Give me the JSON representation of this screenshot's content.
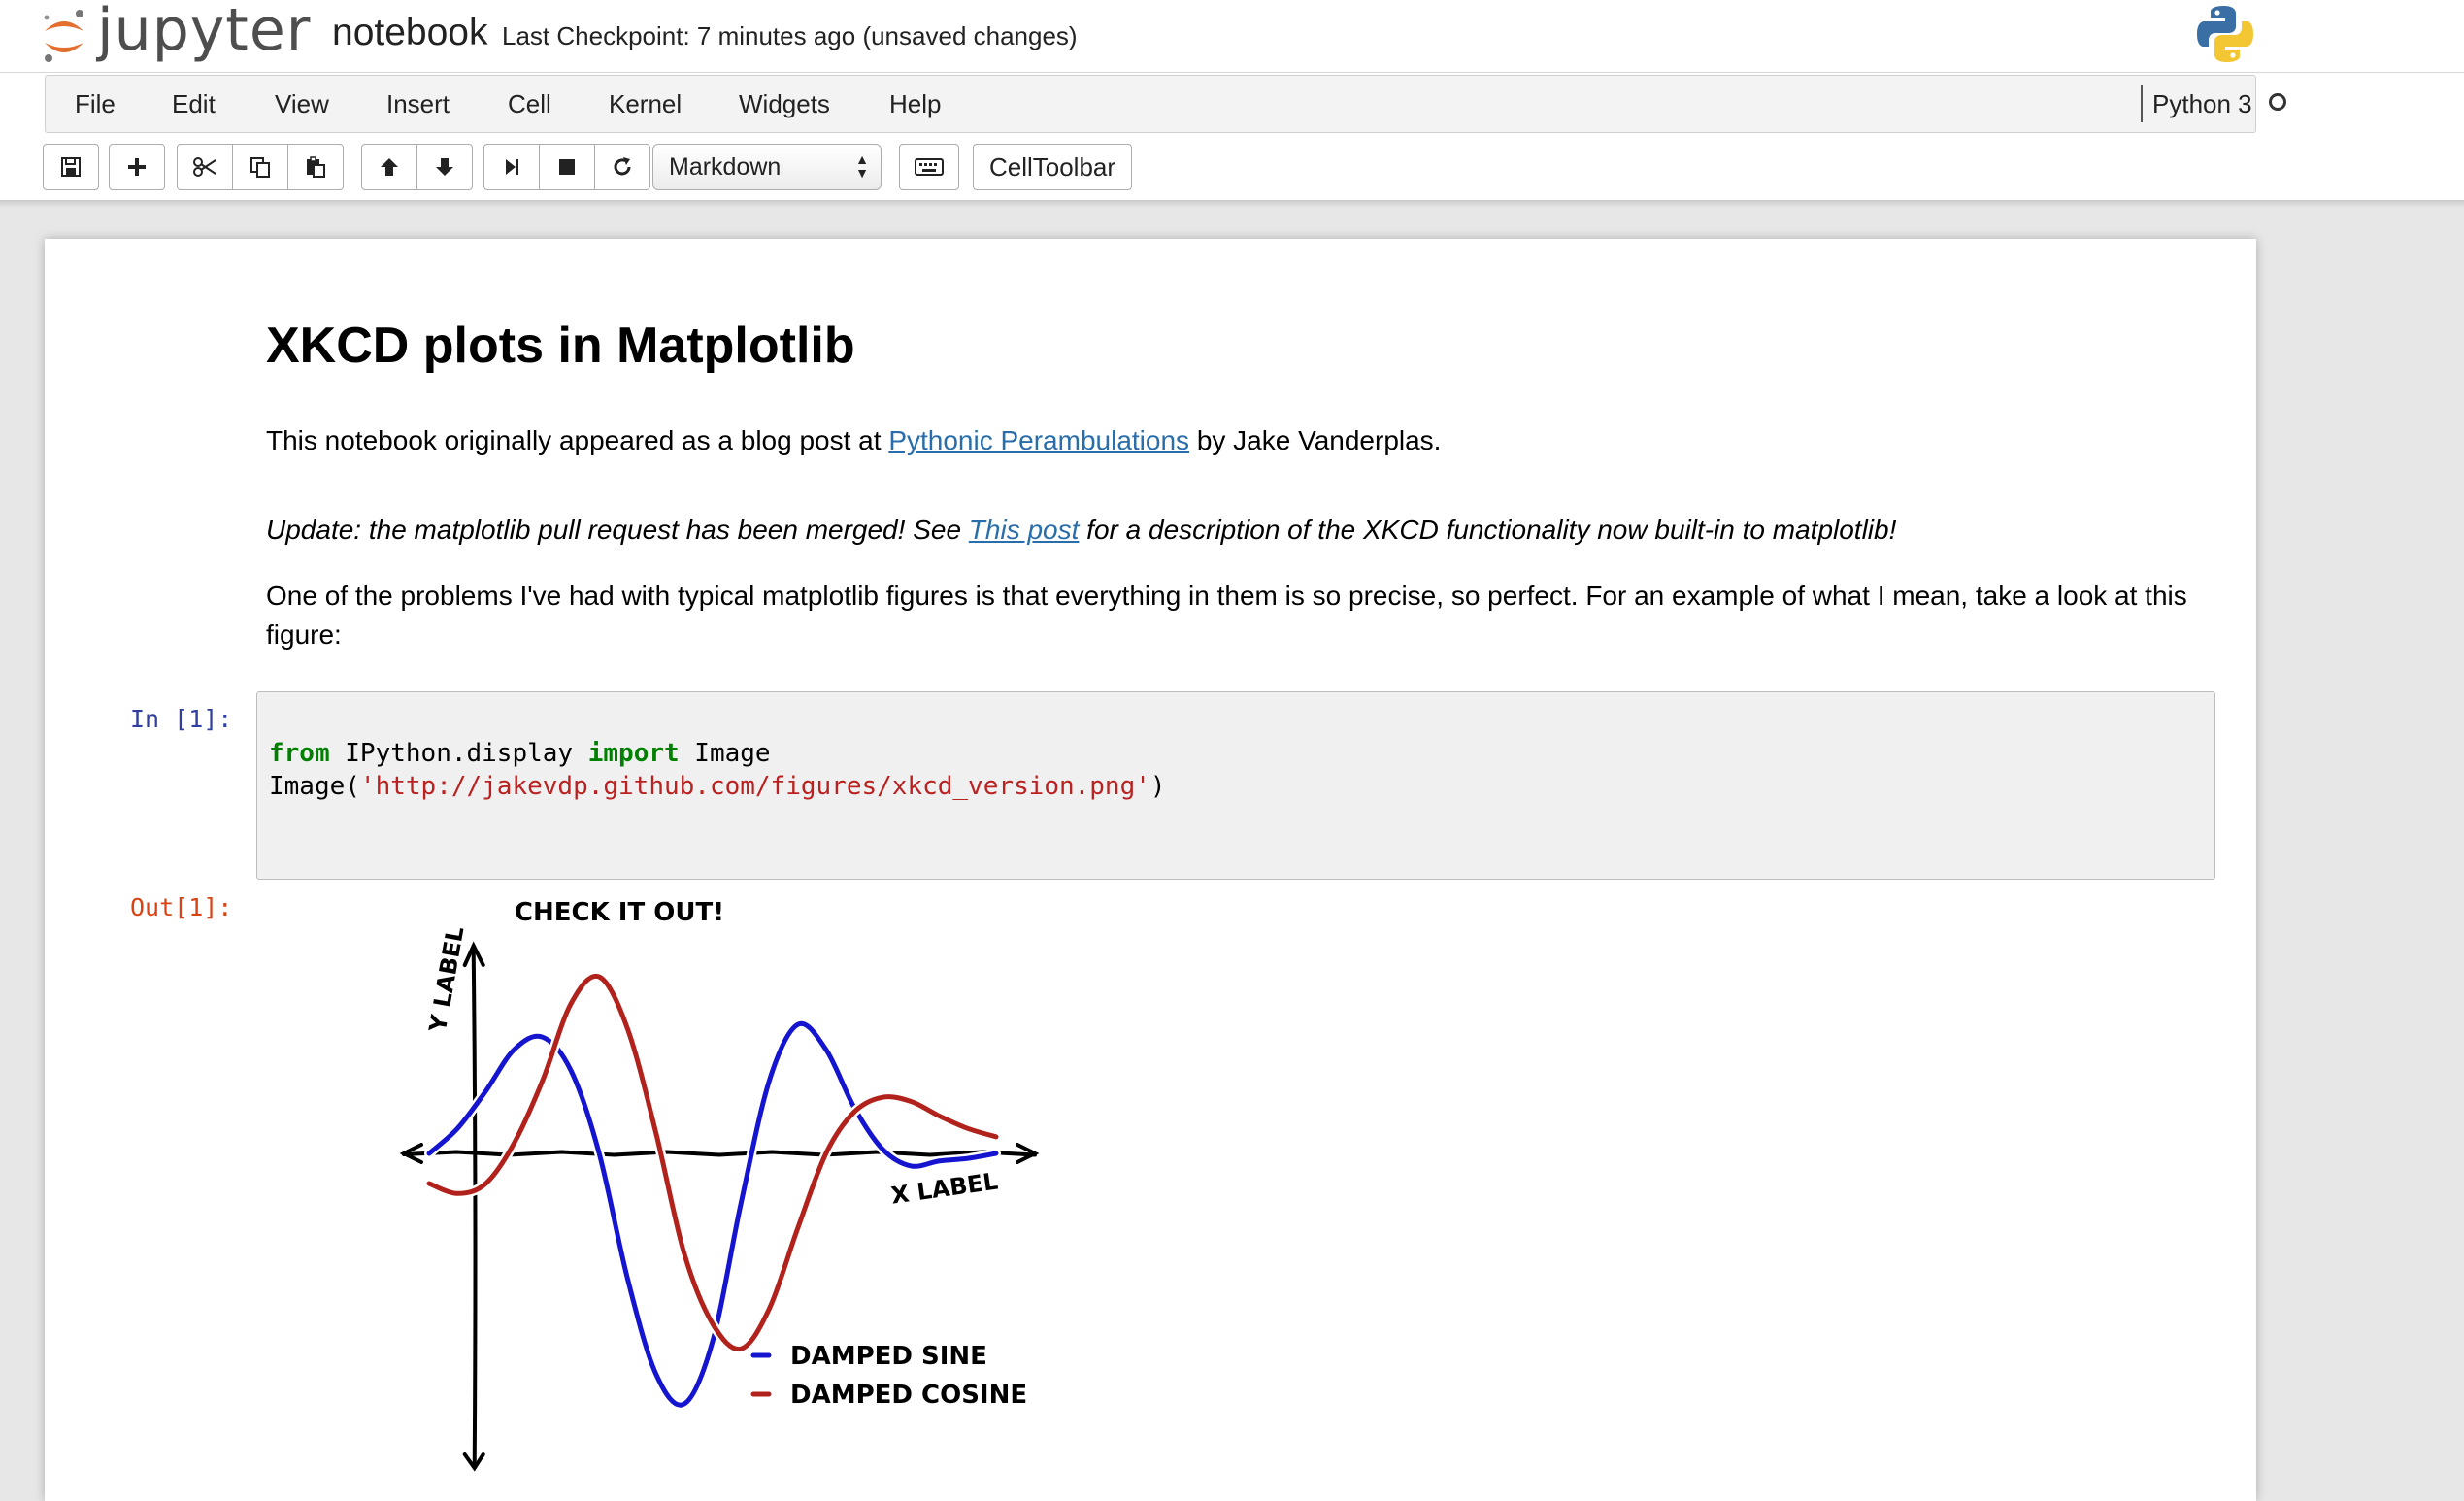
{
  "header": {
    "logo_word": "jupyter",
    "notebook_name": "notebook",
    "checkpoint": "Last Checkpoint: 7 minutes ago (unsaved changes)"
  },
  "menu": {
    "items": [
      "File",
      "Edit",
      "View",
      "Insert",
      "Cell",
      "Kernel",
      "Widgets",
      "Help"
    ],
    "kernel_name": "Python 3"
  },
  "toolbar": {
    "cell_type": "Markdown",
    "celltoolbar_label": "CellToolbar",
    "icons": [
      "save-icon",
      "plus-icon",
      "cut-icon",
      "copy-icon",
      "paste-icon",
      "arrow-up-icon",
      "arrow-down-icon",
      "run-icon",
      "stop-icon",
      "restart-icon",
      "keyboard-icon"
    ]
  },
  "notebook": {
    "title": "XKCD plots in Matplotlib",
    "p1": {
      "before": "This notebook originally appeared as a blog post at ",
      "link": "Pythonic Perambulations",
      "after": " by Jake Vanderplas."
    },
    "p2": {
      "before": "Update: the matplotlib pull request has been merged! See ",
      "link": "This post",
      "after": " for a description of the XKCD functionality now built-in to matplotlib!"
    },
    "p3": "One of the problems I've had with typical matplotlib figures is that everything in them is so precise, so perfect. For an example of what I mean, take a look at this figure:",
    "in_prompt": "In [1]:",
    "out_prompt": "Out[1]:",
    "code": {
      "l1_kw1": "from",
      "l1_mid": " IPython.display ",
      "l1_kw2": "import",
      "l1_end": " Image",
      "l2_start": "Image(",
      "l2_str": "'http://jakevdp.github.com/figures/xkcd_version.png'",
      "l2_end": ")"
    }
  },
  "chart_data": {
    "type": "line",
    "title": "CHECK IT OUT!",
    "xlabel": "X LABEL",
    "ylabel": "Y LABEL",
    "xlim": [
      0,
      10
    ],
    "ylim": [
      -1,
      1
    ],
    "legend_placement": "bottom-right",
    "series": [
      {
        "name": "DAMPED SINE",
        "color": "#1515d0",
        "x": [
          0,
          0.5,
          1,
          1.5,
          2,
          2.5,
          3,
          3.5,
          4,
          4.5,
          5,
          5.5,
          6,
          6.5,
          7,
          7.5,
          8,
          8.5,
          9,
          9.5,
          10
        ],
        "y": [
          0.0,
          0.12,
          0.3,
          0.5,
          0.56,
          0.4,
          0.0,
          -0.5,
          -0.88,
          -1.0,
          -0.75,
          -0.2,
          0.35,
          0.62,
          0.5,
          0.22,
          0.02,
          -0.05,
          -0.03,
          -0.02,
          0.0
        ]
      },
      {
        "name": "DAMPED COSINE",
        "color": "#b2221c",
        "x": [
          0,
          0.5,
          1,
          1.5,
          2,
          2.5,
          3,
          3.5,
          4,
          4.5,
          5,
          5.5,
          6,
          6.5,
          7,
          7.5,
          8,
          8.5,
          9,
          9.5,
          10
        ],
        "y": [
          -0.12,
          -0.16,
          -0.12,
          0.05,
          0.35,
          0.72,
          0.85,
          0.6,
          0.1,
          -0.4,
          -0.68,
          -0.78,
          -0.62,
          -0.3,
          0.0,
          0.2,
          0.27,
          0.25,
          0.18,
          0.12,
          0.08
        ]
      }
    ]
  }
}
